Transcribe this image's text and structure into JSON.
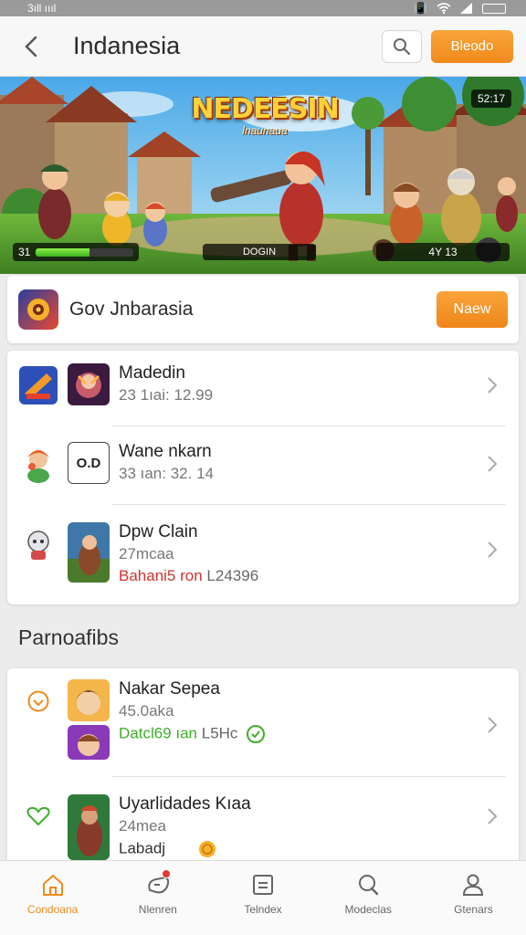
{
  "status_bar": {
    "left": "3ıll ıııl"
  },
  "header": {
    "title": "Indanesia",
    "cta_label": "Bleodo"
  },
  "banner": {
    "title": "NEDEESIN",
    "subtitle": "lnaunaua",
    "counter": "52:17",
    "hud_left_label": "31",
    "hud_progress": 0.55,
    "hud_mid_label": "DOGIN",
    "hud_right_label": "4Y 13"
  },
  "featured": {
    "name": "Gov Jnbarasia",
    "button_label": "Naew"
  },
  "games": [
    {
      "title": "Madedin",
      "meta": "23 1ıai: 12.99"
    },
    {
      "title": "Wane nkarn",
      "meta": "33 ıan: 32. 14",
      "thumb_text": "O.D"
    },
    {
      "title": "Dpw Clain",
      "meta": "27mcaa",
      "extra_prefix": "Bahani5 ron",
      "extra_value": "L24396"
    }
  ],
  "section": {
    "title": "Parnoafibs"
  },
  "players": [
    {
      "title": "Nakar Sepea",
      "meta": "45.0aka",
      "extra_prefix": "Datcl69 ıan",
      "extra_value": "L5Hc"
    },
    {
      "title": "Uyarlidades Kıaa",
      "meta": "24mea",
      "extra_prefix": "Labadj"
    }
  ],
  "nav": [
    {
      "label": "Condoana",
      "icon": "home-icon",
      "active": true
    },
    {
      "label": "Nlenren",
      "icon": "game-controller-icon",
      "badge": true
    },
    {
      "label": "Telndex",
      "icon": "list-icon"
    },
    {
      "label": "Modeclas",
      "icon": "chat-icon"
    },
    {
      "label": "Gtenars",
      "icon": "profile-icon"
    }
  ],
  "colors": {
    "accent": "#F08A1C",
    "red_text": "#D2332B",
    "green_text": "#3FAE2A",
    "page_bg": "#ECECEC"
  }
}
